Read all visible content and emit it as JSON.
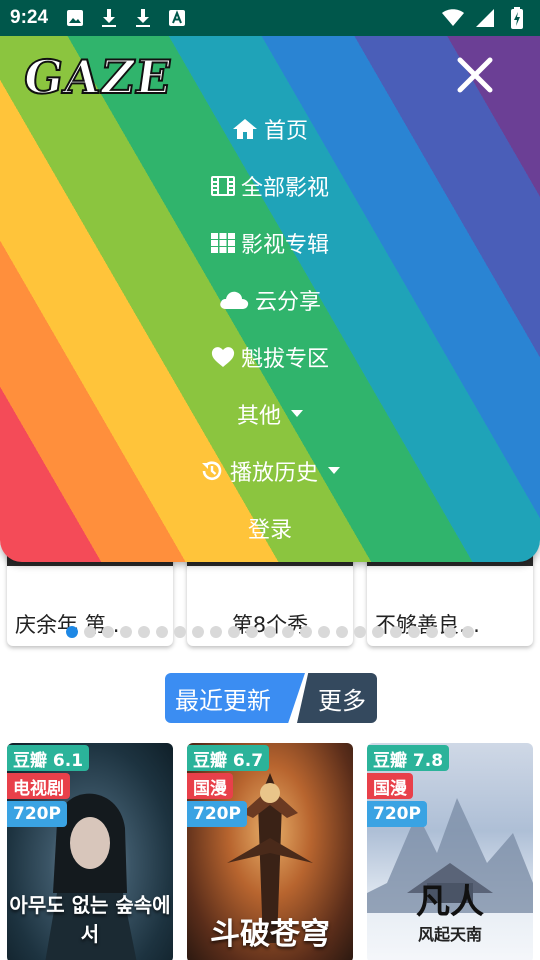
{
  "status_bar": {
    "time": "9:24"
  },
  "menu": {
    "logo": "GAZE",
    "items": [
      {
        "label": "首页",
        "icon": "home-icon"
      },
      {
        "label": "全部影视",
        "icon": "film-icon"
      },
      {
        "label": "影视专辑",
        "icon": "grid-icon"
      },
      {
        "label": "云分享",
        "icon": "cloud-icon"
      },
      {
        "label": "魁拔专区",
        "icon": "heart-icon"
      },
      {
        "label": "其他",
        "icon": "caret-down-icon"
      },
      {
        "label": "播放历史",
        "icon": "history-icon"
      },
      {
        "label": "登录",
        "icon": ""
      }
    ]
  },
  "carousel": {
    "items": [
      {
        "title": "庆余年 第…"
      },
      {
        "title": "第8个秀"
      },
      {
        "title": "不够善良…"
      }
    ],
    "dot_count": 23,
    "active_index": 0
  },
  "section": {
    "title": "最近更新",
    "more_label": "更多"
  },
  "posters": [
    {
      "score": "豆瓣 6.1",
      "genre": "电视剧",
      "resolution": "720P",
      "art_text": "아무도 없는 숲속에서"
    },
    {
      "score": "豆瓣 6.7",
      "genre": "国漫",
      "resolution": "720P",
      "art_text": "斗破苍穹"
    },
    {
      "score": "豆瓣 7.8",
      "genre": "国漫",
      "resolution": "720P",
      "art_text": "凡人",
      "art_sub": "风起天南"
    }
  ]
}
